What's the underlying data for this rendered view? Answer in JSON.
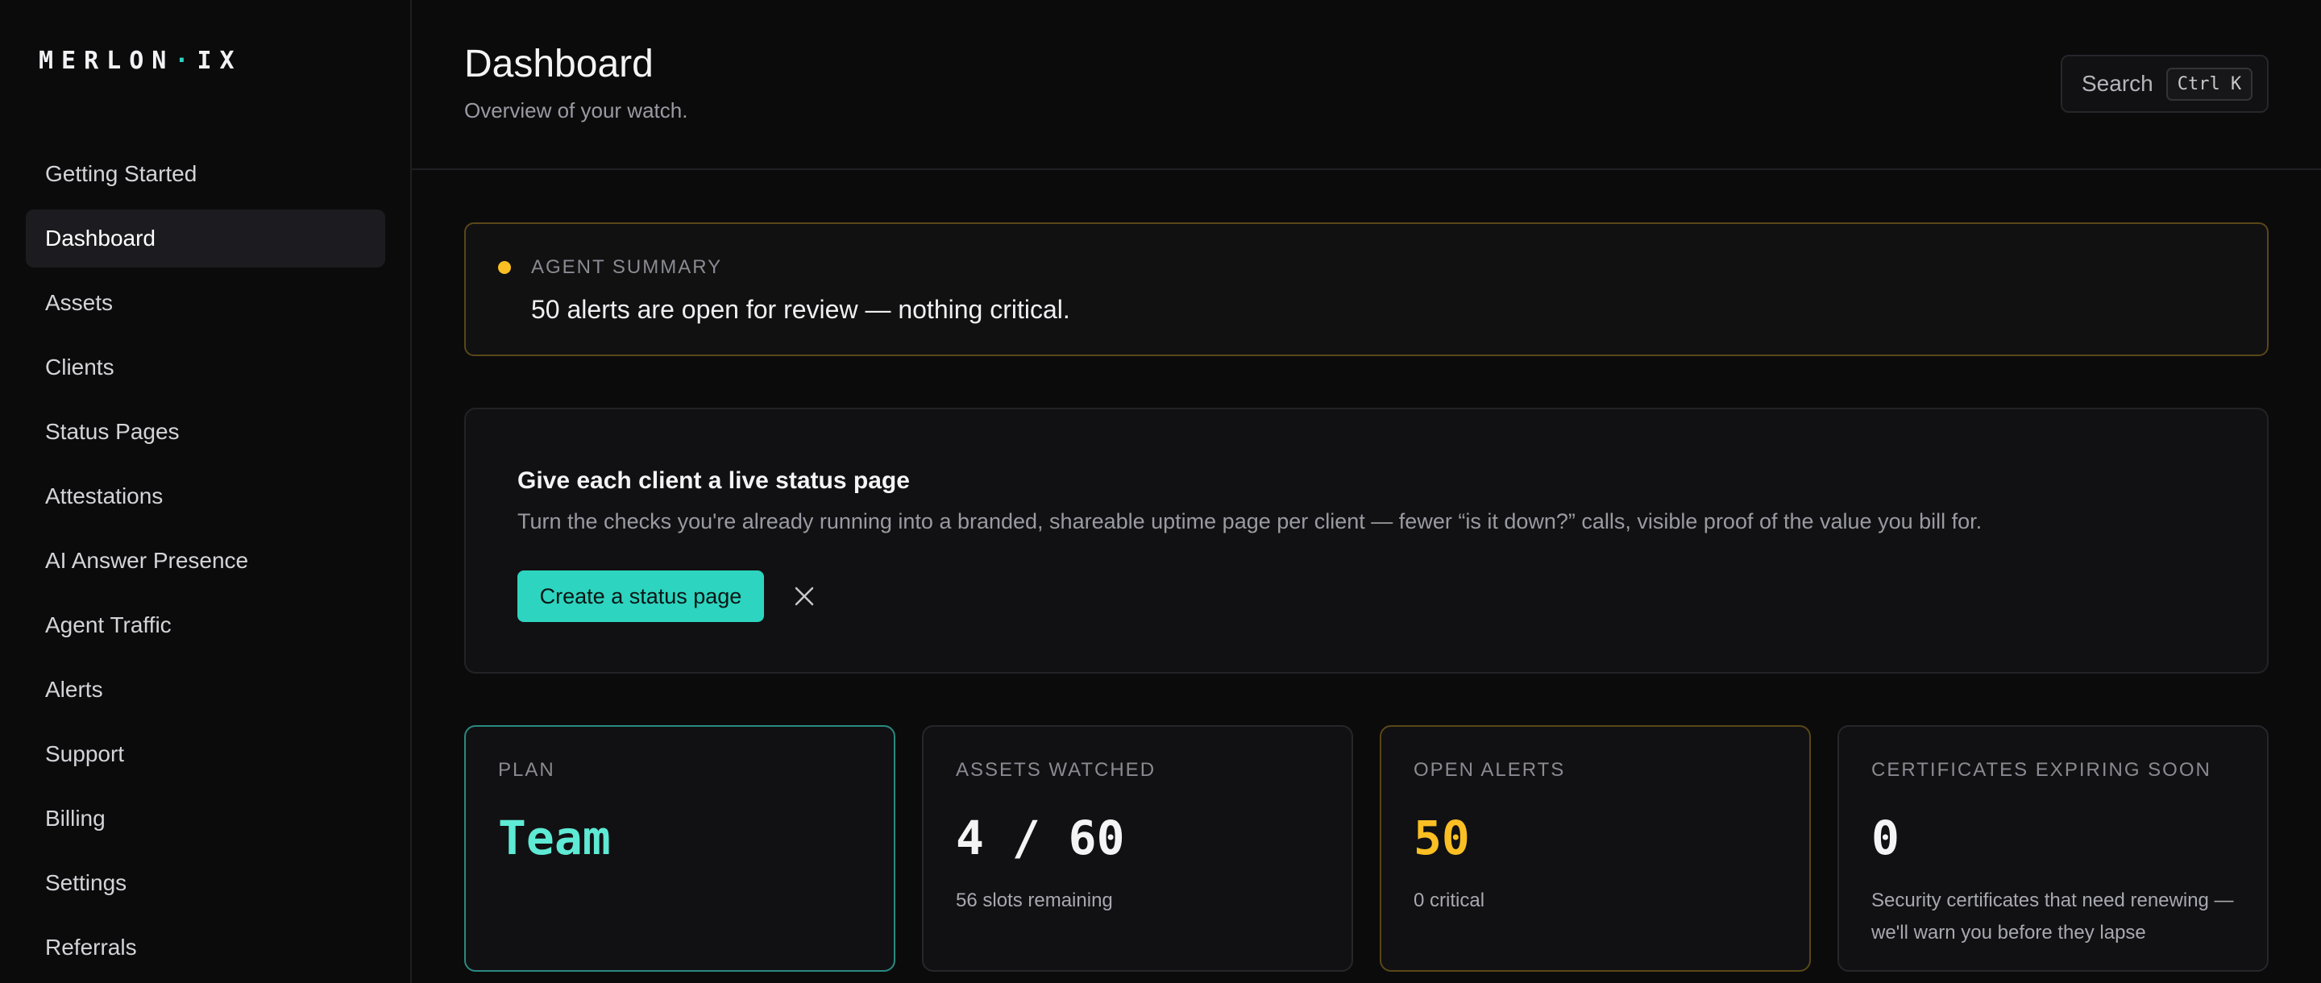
{
  "brand": {
    "logo_main": "MERLON",
    "logo_dot": "·",
    "logo_suffix": "IX",
    "accent_color": "#2dd4bf",
    "warn_color": "#fbbf24"
  },
  "sidebar": {
    "items": [
      {
        "label": "Getting Started",
        "active": false
      },
      {
        "label": "Dashboard",
        "active": true
      },
      {
        "label": "Assets",
        "active": false
      },
      {
        "label": "Clients",
        "active": false
      },
      {
        "label": "Status Pages",
        "active": false
      },
      {
        "label": "Attestations",
        "active": false
      },
      {
        "label": "AI Answer Presence",
        "active": false
      },
      {
        "label": "Agent Traffic",
        "active": false
      },
      {
        "label": "Alerts",
        "active": false
      },
      {
        "label": "Support",
        "active": false
      },
      {
        "label": "Billing",
        "active": false
      },
      {
        "label": "Settings",
        "active": false
      },
      {
        "label": "Referrals",
        "active": false
      }
    ]
  },
  "header": {
    "title": "Dashboard",
    "subtitle": "Overview of your watch.",
    "search_label": "Search",
    "search_shortcut": "Ctrl K"
  },
  "agent_summary": {
    "label": "AGENT SUMMARY",
    "text": "50 alerts are open for review — nothing critical."
  },
  "promo": {
    "title": "Give each client a live status page",
    "body": "Turn the checks you're already running into a branded, shareable uptime page per client — fewer “is it down?” calls, visible proof of the value you bill for.",
    "cta_label": "Create a status page",
    "close_icon": "close-icon"
  },
  "cards": [
    {
      "label": "PLAN",
      "value": "Team",
      "sub": ""
    },
    {
      "label": "ASSETS WATCHED",
      "value": "4 / 60",
      "sub": "56 slots remaining"
    },
    {
      "label": "OPEN ALERTS",
      "value": "50",
      "sub": "0 critical"
    },
    {
      "label": "CERTIFICATES EXPIRING SOON",
      "value": "0",
      "sub": "Security certificates that need renewing — we'll warn you before they lapse"
    }
  ]
}
